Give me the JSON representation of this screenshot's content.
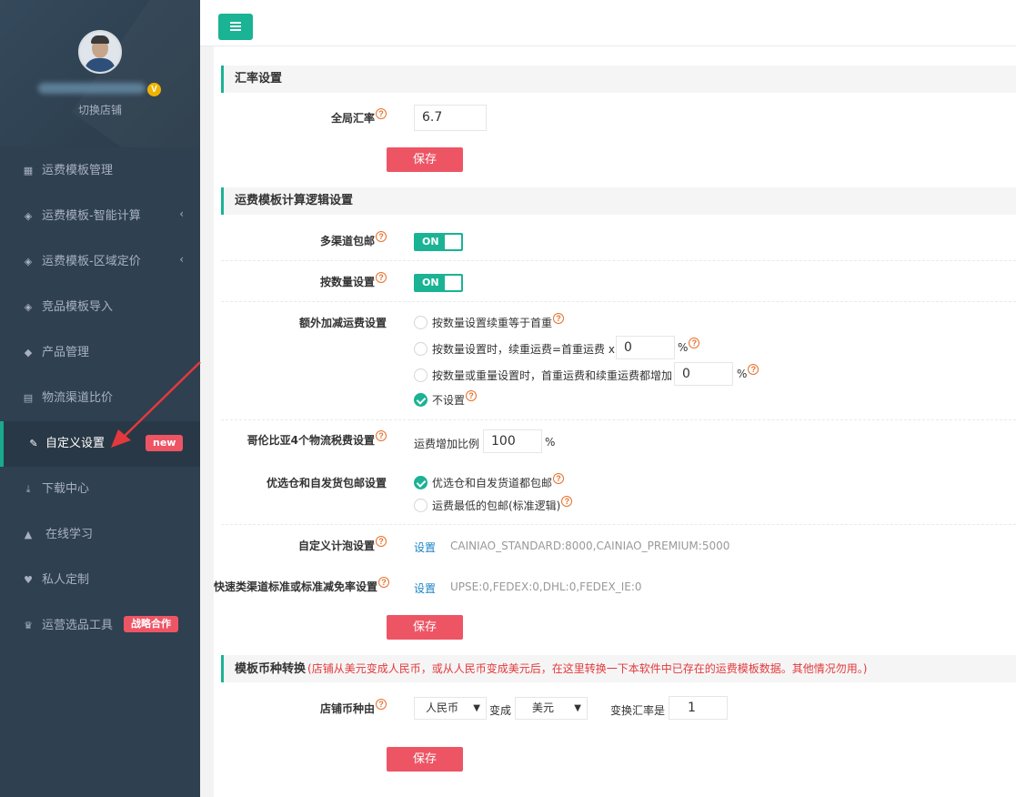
{
  "sidebar": {
    "switch_shop": "切换店铺",
    "verified_badge": "V",
    "items": [
      {
        "label": "运费模板管理",
        "icon": "grid-icon",
        "glyph": "▦"
      },
      {
        "label": "运费模板-智能计算",
        "icon": "diamond-icon",
        "glyph": "◈",
        "caret": "‹"
      },
      {
        "label": "运费模板-区域定价",
        "icon": "diamond-icon",
        "glyph": "◈",
        "caret": "‹"
      },
      {
        "label": "竞品模板导入",
        "icon": "diamond-icon",
        "glyph": "◈"
      },
      {
        "label": "产品管理",
        "icon": "cube-icon",
        "glyph": "◆"
      },
      {
        "label": "物流渠道比价",
        "icon": "calculator-icon",
        "glyph": "▤"
      },
      {
        "label": "自定义设置",
        "icon": "wrench-icon",
        "glyph": "✎",
        "tag": "new"
      },
      {
        "label": "下载中心",
        "icon": "download-icon",
        "glyph": "⤓"
      },
      {
        "label": "在线学习",
        "icon": "graduation-cap-icon",
        "glyph": "▲"
      },
      {
        "label": "私人定制",
        "icon": "heart-icon",
        "glyph": "♥"
      },
      {
        "label": "运营选品工具",
        "icon": "trophy-icon",
        "glyph": "♛",
        "tag": "战略合作"
      }
    ]
  },
  "sections": {
    "rate": {
      "title": "汇率设置",
      "global_rate_label": "全局汇率",
      "global_rate_value": "6.7",
      "save": "保存"
    },
    "logic": {
      "title": "运费模板计算逻辑设置",
      "multi_channel_label": "多渠道包邮",
      "multi_channel_state": "ON",
      "by_quantity_label": "按数量设置",
      "by_quantity_state": "ON",
      "extra_label": "额外加减运费设置",
      "extra_opt1": "按数量设置续重等于首重",
      "extra_opt2_prefix": "按数量设置时，续重运费=首重运费 x",
      "extra_opt2_value": "0",
      "extra_opt2_suffix": "%",
      "extra_opt3_prefix": "按数量或重量设置时，首重运费和续重运费都增加",
      "extra_opt3_value": "0",
      "extra_opt3_suffix": "%",
      "extra_opt4": "不设置",
      "colombia_label": "哥伦比亚4个物流税费设置",
      "colombia_prefix": "运费增加比例",
      "colombia_value": "100",
      "colombia_suffix": "%",
      "warehouse_label": "优选仓和自发货包邮设置",
      "warehouse_opt1": "优选仓和自发货道都包邮",
      "warehouse_opt2": "运费最低的包邮(标准逻辑)",
      "bubble_label": "自定义计泡设置",
      "bubble_link": "设置",
      "bubble_value": "CAINIAO_STANDARD:8000,CAINIAO_PREMIUM:5000",
      "express_label": "快速类渠道标准或标准减免率设置",
      "express_link": "设置",
      "express_value": "UPSE:0,FEDEX:0,DHL:0,FEDEX_IE:0",
      "save": "保存"
    },
    "currency": {
      "title": "模板币种转换",
      "note": "(店铺从美元变成人民币，或从人民币变成美元后，在这里转换一下本软件中已存在的运费模板数据。其他情况勿用。)",
      "shop_currency_label": "店铺币种由",
      "from_currency": "人民币",
      "change_to": "变成",
      "to_currency": "美元",
      "rate_label": "变换汇率是",
      "rate_value": "1",
      "save": "保存"
    }
  },
  "colors": {
    "sidebar_bg": "#2f4050",
    "accent": "#1ab394",
    "danger": "#ed5565",
    "link": "#1c84c6"
  }
}
